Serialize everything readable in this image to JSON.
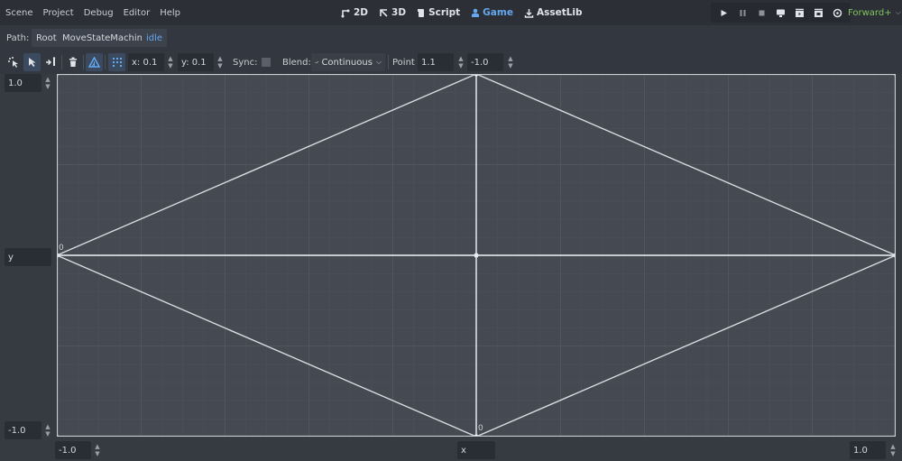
{
  "menu": [
    "Scene",
    "Project",
    "Debug",
    "Editor",
    "Help"
  ],
  "workspaces": [
    {
      "label": "2D",
      "icon": "2d-icon",
      "active": false
    },
    {
      "label": "3D",
      "icon": "3d-icon",
      "active": false
    },
    {
      "label": "Script",
      "icon": "script-icon",
      "active": false
    },
    {
      "label": "Game",
      "icon": "game-icon",
      "active": true
    },
    {
      "label": "AssetLib",
      "icon": "assetlib-icon",
      "active": false
    }
  ],
  "run_buttons": [
    "play-icon",
    "pause-icon",
    "stop-icon",
    "remote-debug-icon",
    "play-scene-icon",
    "play-custom-scene-icon",
    "movie-maker-icon"
  ],
  "renderer": {
    "label": "Forward+",
    "color": "#7fc55e"
  },
  "path": {
    "label": "Path:",
    "crumbs": [
      "Root",
      "MoveStateMachine",
      "idle"
    ]
  },
  "toolbar": {
    "tools": [
      "select-points-icon",
      "create-points-icon",
      "create-triangles-icon",
      "erase-icon",
      "blend-triangle-icon",
      "snap-grid-icon"
    ],
    "snap_x": "x: 0.1",
    "snap_y": "y: 0.1",
    "sync_label": "Sync:",
    "sync_checked": false,
    "blend_label": "Blend:",
    "blend_mode": "Continuous",
    "point_label": "Point",
    "point_x": "1.1",
    "point_y": "-1.0"
  },
  "blend_space": {
    "max_y": "1.0",
    "y_label": "y",
    "min_y": "-1.0",
    "min_x": "-1.0",
    "x_label": "x",
    "max_x": "1.0",
    "zero_label": "0",
    "accent": "#4a90d9"
  }
}
